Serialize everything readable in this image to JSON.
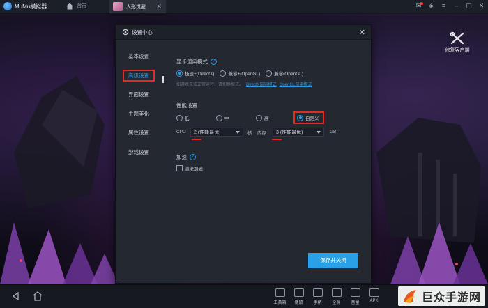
{
  "titlebar": {
    "app_title": "MuMu模拟器",
    "home_label": "首页",
    "active_tab": "人形觉醒"
  },
  "repair": {
    "label": "修复客户端"
  },
  "dialog": {
    "title": "设置中心",
    "nav": [
      "基本设置",
      "高级设置",
      "界面设置",
      "主题美化",
      "属性设置",
      "游戏设置"
    ],
    "render": {
      "title": "显卡渲染模式",
      "options": [
        "极速+(DirectX)",
        "兼容+(OpenGL)",
        "兼容(OpenGL)"
      ],
      "selected": "极速+(DirectX)",
      "hint": "如游戏无法正常运行，请切换模式。",
      "link1": "DirectX渲染模式",
      "link2": "OpenGL渲染模式"
    },
    "performance": {
      "title": "性能设置",
      "options": [
        "低",
        "中",
        "高",
        "自定义"
      ],
      "selected": "自定义",
      "cpu_label": "CPU",
      "cpu_value": "2 (性能最优)",
      "cpu_unit": "核",
      "mem_label": "内存",
      "mem_value": "3 (性能最优)",
      "mem_unit": "GB"
    },
    "accel": {
      "title": "加速",
      "checkbox_label": "渲染加速"
    },
    "save_label": "保存并关闭"
  },
  "toolbar": {
    "tools": [
      "工具箱",
      "键鼠",
      "手柄",
      "全屏",
      "音量",
      "APK"
    ]
  },
  "watermark": {
    "text": "巨众手游网"
  }
}
